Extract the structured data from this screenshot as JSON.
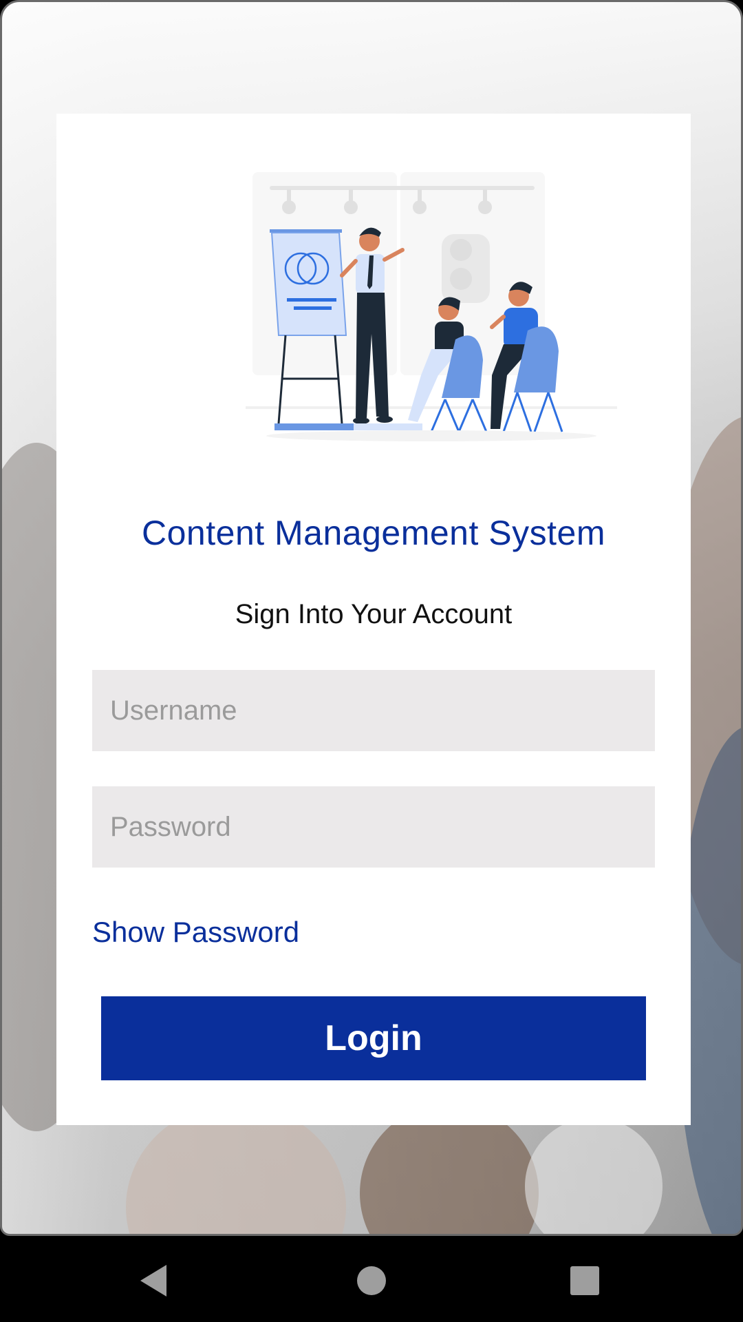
{
  "app": {
    "title": "Content Management System",
    "subtitle": "Sign Into Your Account"
  },
  "form": {
    "username_placeholder": "Username",
    "username_value": "",
    "password_placeholder": "Password",
    "password_value": "",
    "show_password_label": "Show Password",
    "login_label": "Login"
  },
  "colors": {
    "brand": "#0a2f9b",
    "field_bg": "#ebe9ea",
    "placeholder": "#9a9a9a"
  },
  "icons": {
    "illustration": "presentation-illustration",
    "nav_back": "back-triangle-icon",
    "nav_home": "home-circle-icon",
    "nav_recents": "recents-square-icon"
  }
}
